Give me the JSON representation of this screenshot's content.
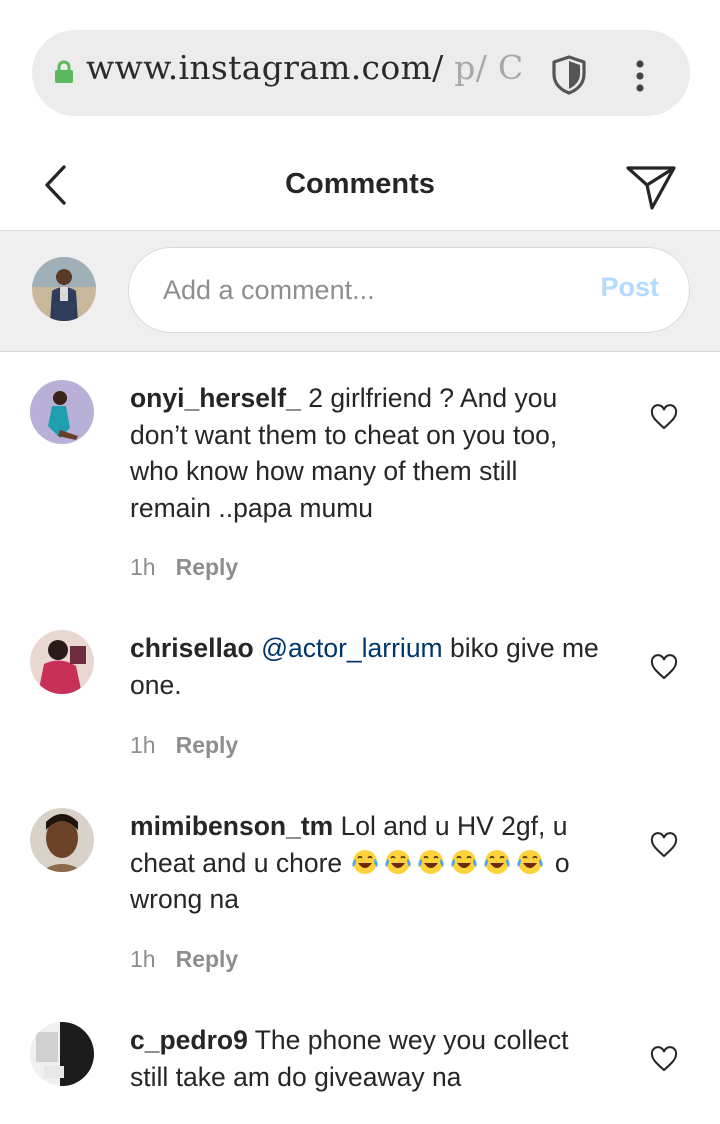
{
  "browser": {
    "url_main": "www.instagram.com/",
    "url_faded": " p/ C",
    "icons": [
      "lock-icon",
      "shield-icon",
      "kebab-menu-icon"
    ]
  },
  "header": {
    "title": "Comments",
    "icons": [
      "back-chevron-icon",
      "send-icon"
    ]
  },
  "composer": {
    "placeholder": "Add a comment...",
    "post_label": "Post",
    "post_color": "#b3dbff"
  },
  "comments": [
    {
      "username": "onyi_herself_",
      "text": " 2 girlfriend ? And you don’t want them to cheat on you too, who know how many of them still remain ..papa mumu",
      "time": "1h",
      "reply_label": "Reply"
    },
    {
      "username": "chrisellao",
      "mention": "@actor_larrium",
      "text": " biko give me one.",
      "time": "1h",
      "reply_label": "Reply"
    },
    {
      "username": "mimibenson_tm",
      "text": " Lol and u HV 2gf, u cheat and u chore ",
      "emoji": "😂",
      "emoji_count": 6,
      "text_after": " o wrong na",
      "time": "1h",
      "reply_label": "Reply"
    },
    {
      "username": "c_pedro9",
      "text": " The phone wey you collect still take am do giveaway na"
    }
  ],
  "colors": {
    "mention": "#00376b",
    "meta": "#8e8e8e",
    "composer_bg": "#efefef"
  }
}
